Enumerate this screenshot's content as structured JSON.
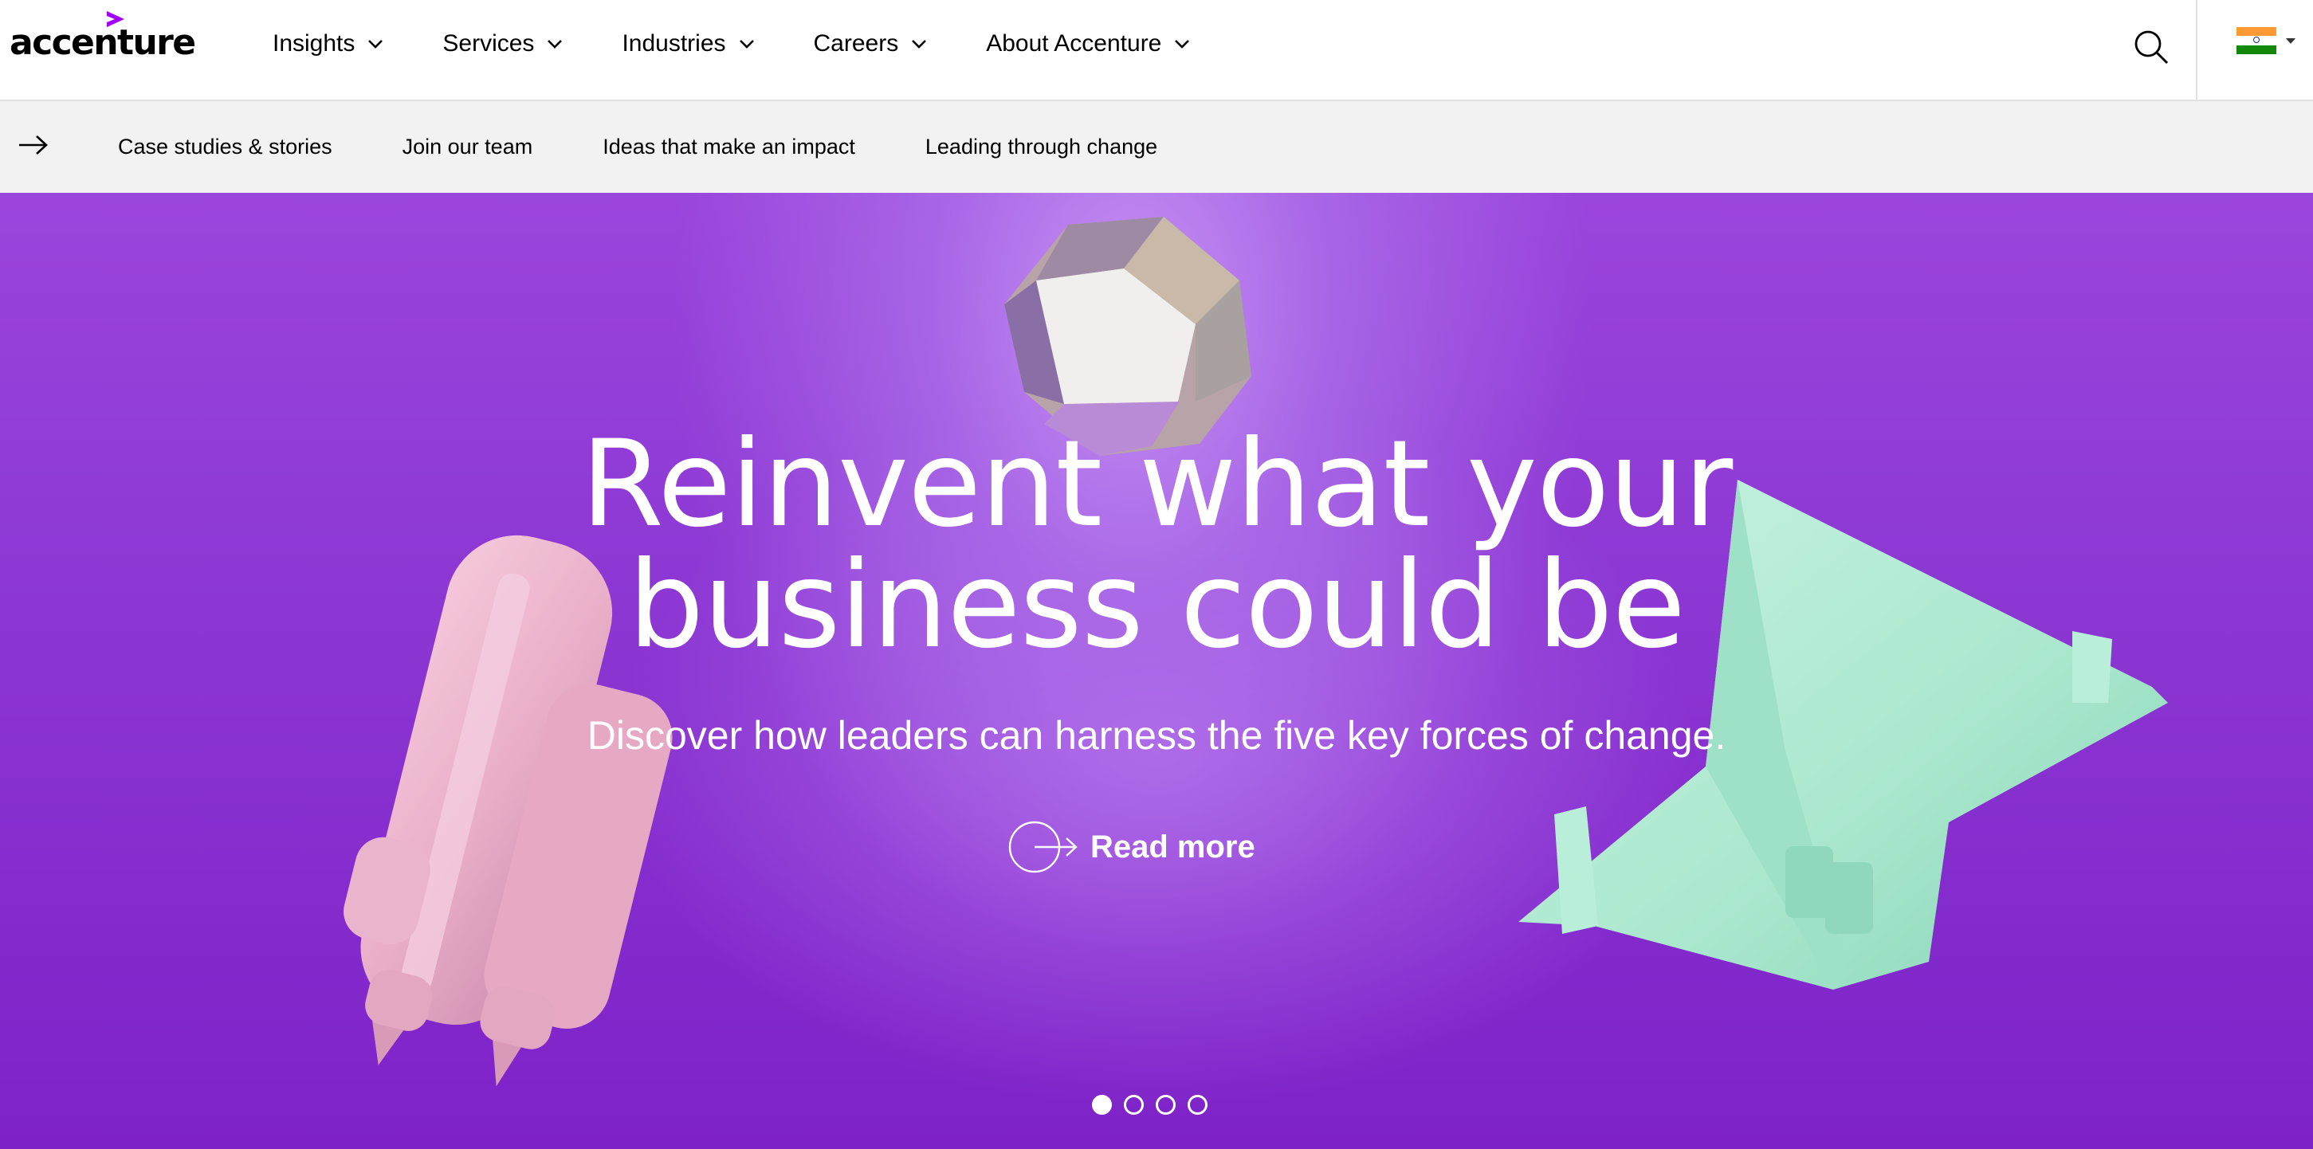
{
  "header": {
    "logo_text": "accenture",
    "brand_color": "#a100ff",
    "menu": [
      {
        "label": "Insights"
      },
      {
        "label": "Services"
      },
      {
        "label": "Industries"
      },
      {
        "label": "Careers"
      },
      {
        "label": "About Accenture"
      }
    ],
    "search_icon": "search-icon",
    "country_flag": "india-flag-icon"
  },
  "subnav": {
    "arrow_icon": "arrow-right-icon",
    "links": [
      {
        "label": "Case studies & stories"
      },
      {
        "label": "Join our team"
      },
      {
        "label": "Ideas that make an impact"
      },
      {
        "label": "Leading through change"
      }
    ]
  },
  "hero": {
    "title_line1": "Reinvent what your",
    "title_line2": "business could be",
    "subtitle": "Discover how leaders can harness the five key forces of change.",
    "cta_label": "Read more",
    "cta_icon": "circle-arrow-right-icon",
    "background_color": "#8d38d4",
    "carousel": {
      "total": 4,
      "active": 1
    }
  }
}
